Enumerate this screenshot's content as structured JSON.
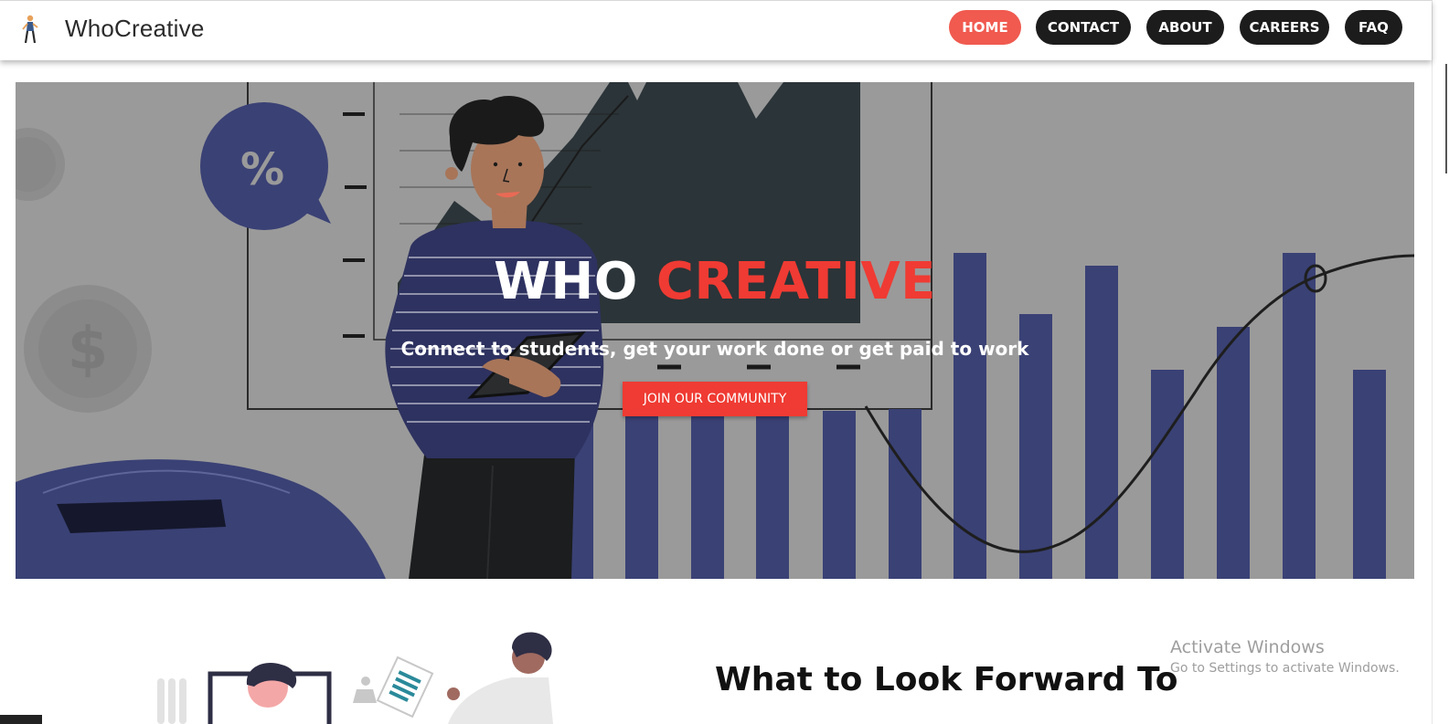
{
  "brand": {
    "name": "WhoCreative"
  },
  "nav": {
    "items": [
      "HOME",
      "CONTACT",
      "ABOUT",
      "CAREERS",
      "FAQ"
    ],
    "active": "HOME"
  },
  "hero": {
    "title_word1": "WHO",
    "title_word2": "CREATIVE",
    "subtitle": "Connect to students, get your work done or get paid to work",
    "button_label": "JOIN OUR COMMUNITY",
    "speech_bubble_symbol": "%",
    "coin_symbol": "$"
  },
  "section": {
    "title": "What to Look Forward To"
  },
  "watermark": {
    "line1": "Activate Windows",
    "line2": "Go to Settings to activate Windows."
  },
  "colors": {
    "accent": "#ef3b33",
    "nav_active": "#f05a4f",
    "nav_bg": "#1c1c1c",
    "bars": "#3a4175",
    "hero_bg": "#9a9a9a"
  },
  "icons": [
    "logo-person-icon"
  ]
}
